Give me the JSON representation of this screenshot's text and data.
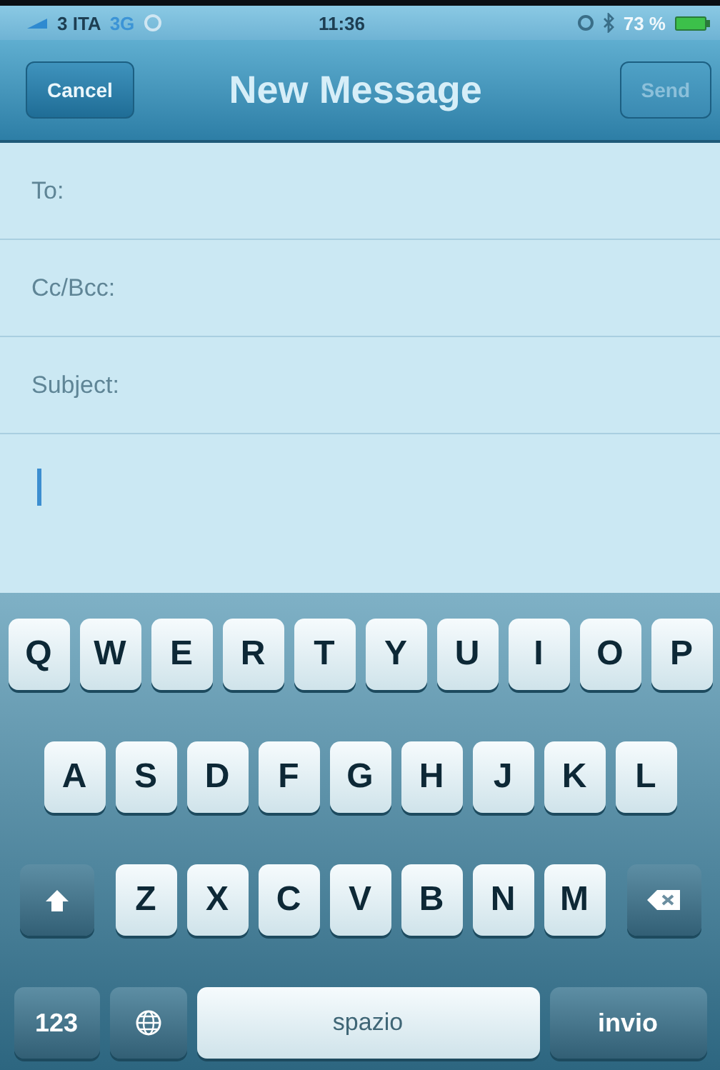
{
  "status_bar": {
    "carrier": "3 ITA",
    "network": "3G",
    "time": "11:36",
    "battery_text": "73 %"
  },
  "nav_bar": {
    "title": "New Message",
    "buttons": [
      {
        "label": "Cancel",
        "disabled": false
      },
      {
        "label": "Send",
        "disabled": true
      }
    ]
  },
  "fields": [
    {
      "label": "To:"
    },
    {
      "label": "Cc/Bcc:"
    },
    {
      "label": "Subject:"
    }
  ],
  "body": {
    "cursor": true
  },
  "keyboard": {
    "letter_rows": [
      [
        {
          "kind": "letter",
          "label": "Q"
        },
        {
          "kind": "letter",
          "label": "W"
        },
        {
          "kind": "letter",
          "label": "E"
        },
        {
          "kind": "letter",
          "label": "R"
        },
        {
          "kind": "letter",
          "label": "T"
        },
        {
          "kind": "letter",
          "label": "Y"
        },
        {
          "kind": "letter",
          "label": "U"
        },
        {
          "kind": "letter",
          "label": "I"
        },
        {
          "kind": "letter",
          "label": "O"
        },
        {
          "kind": "letter",
          "label": "P"
        }
      ],
      [
        {
          "kind": "letter",
          "label": "A"
        },
        {
          "kind": "letter",
          "label": "S"
        },
        {
          "kind": "letter",
          "label": "D"
        },
        {
          "kind": "letter",
          "label": "F"
        },
        {
          "kind": "letter",
          "label": "G"
        },
        {
          "kind": "letter",
          "label": "H"
        },
        {
          "kind": "letter",
          "label": "J"
        },
        {
          "kind": "letter",
          "label": "K"
        },
        {
          "kind": "letter",
          "label": "L"
        }
      ],
      [
        {
          "kind": "shift"
        },
        {
          "kind": "letter",
          "label": "Z"
        },
        {
          "kind": "letter",
          "label": "X"
        },
        {
          "kind": "letter",
          "label": "C"
        },
        {
          "kind": "letter",
          "label": "V"
        },
        {
          "kind": "letter",
          "label": "B"
        },
        {
          "kind": "letter",
          "label": "N"
        },
        {
          "kind": "letter",
          "label": "M"
        },
        {
          "kind": "delete"
        }
      ]
    ],
    "bottom_bar": {
      "keys": [
        {
          "kind": "numbers",
          "label": "123"
        },
        {
          "kind": "globe"
        },
        {
          "kind": "space",
          "label": "spazio"
        },
        {
          "kind": "return",
          "label": "invio"
        }
      ]
    }
  }
}
